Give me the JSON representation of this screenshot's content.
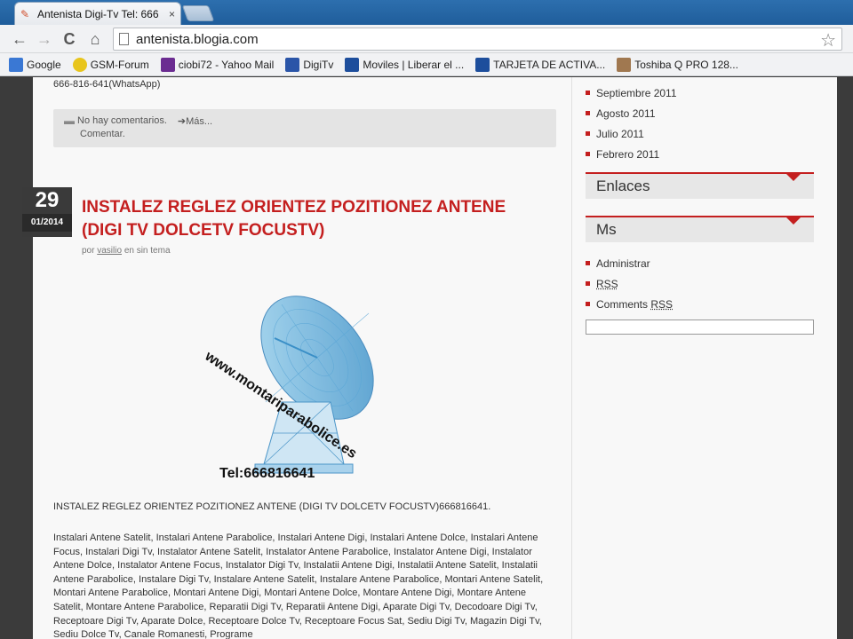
{
  "browser": {
    "tab_title": "Antenista Digi-Tv Tel: 666",
    "tab_close": "×",
    "url": "antenista.blogia.com",
    "back": "←",
    "forward": "→",
    "reload": "C",
    "home": "⌂",
    "star": "☆"
  },
  "bookmarks": [
    {
      "label": "Google",
      "color": "#3a78d4"
    },
    {
      "label": "GSM-Forum",
      "color": "#e8c51c"
    },
    {
      "label": "ciobi72 - Yahoo Mail",
      "color": "#6b2c91"
    },
    {
      "label": "DigiTv",
      "color": "#2a55a8"
    },
    {
      "label": "Moviles | Liberar el ...",
      "color": "#1d4e9c"
    },
    {
      "label": "TARJETA DE ACTIVA...",
      "color": "#1d4e9c"
    },
    {
      "label": "Toshiba Q PRO 128...",
      "color": "#a07850"
    }
  ],
  "prev_post": {
    "whatsapp": "666-816-641(WhatsApp)",
    "no_comments": "No hay comentarios.",
    "more": "Más...",
    "comment": "Comentar."
  },
  "post": {
    "day": "29",
    "month_year": "01/2014",
    "title": "INSTALEZ REGLEZ ORIENTEZ POZITIONEZ ANTENE (DIGI TV DOLCETV FOCUSTV)",
    "by": "por",
    "author": "vasilio",
    "category": "en sin tema",
    "image_web": "www.montariparabolice.es",
    "image_tel": "Tel:666816641",
    "lead": "INSTALEZ REGLEZ ORIENTEZ POZITIONEZ ANTENE (DIGI TV DOLCETV FOCUSTV)666816641.",
    "body": "Instalari Antene Satelit, Instalari Antene Parabolice, Instalari Antene Digi, Instalari Antene Dolce, Instalari Antene Focus, Instalari Digi Tv, Instalator Antene Satelit, Instalator Antene Parabolice, Instalator Antene Digi, Instalator Antene Dolce, Instalator Antene Focus, Instalator Digi Tv, Instalatii Antene Digi, Instalatii Antene Satelit, Instalatii Antene Parabolice, Instalare Digi Tv, Instalare Antene Satelit, Instalare Antene Parabolice, Montari Antene Satelit, Montari Antene Parabolice, Montari Antene Digi, Montari Antene Dolce, Montare Antene Digi, Montare Antene Satelit, Montare Antene Parabolice, Reparatii Digi Tv, Reparatii Antene Digi, Aparate Digi Tv, Decodoare Digi Tv, Receptoare Digi Tv, Aparate Dolce, Receptoare Dolce Tv, Receptoare Focus Sat, Sediu Digi Tv, Magazin Digi Tv, Sediu Dolce Tv, Canale Romanesti, Programe"
  },
  "sidebar": {
    "archive": [
      "Septiembre 2011",
      "Agosto 2011",
      "Julio 2011",
      "Febrero 2011"
    ],
    "enlaces": "Enlaces",
    "ms": "Ms",
    "meta": {
      "admin": "Administrar",
      "rss": "RSS",
      "comments": "Comments",
      "comments_rss": "RSS"
    }
  },
  "colors": {
    "accent": "#c41f1f",
    "titlebar": "#2a6aa8"
  }
}
